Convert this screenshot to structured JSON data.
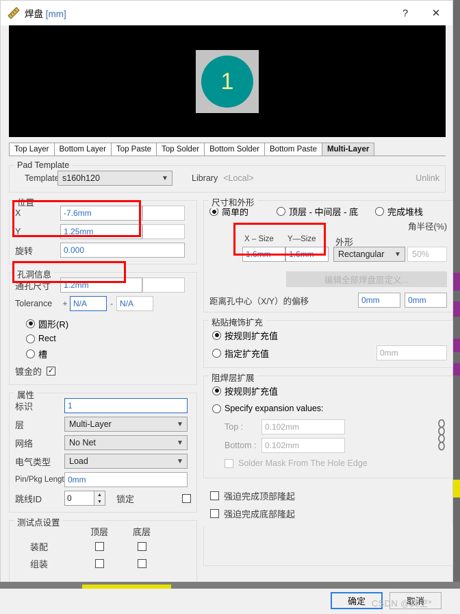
{
  "window": {
    "title": "焊盘",
    "title_unit": "[mm]",
    "icon": "ruler-icon",
    "help_glyph": "?",
    "close_glyph": "✕"
  },
  "preview": {
    "designator": "1",
    "pad_color": "#009291",
    "square_color": "#c3c3c3",
    "background_color": "#000000",
    "text_color": "#f5eb9a"
  },
  "tabs": [
    {
      "label": "Top Layer",
      "active": false
    },
    {
      "label": "Bottom Layer",
      "active": false
    },
    {
      "label": "Top Paste",
      "active": false
    },
    {
      "label": "Top Solder",
      "active": false
    },
    {
      "label": "Bottom Solder",
      "active": false
    },
    {
      "label": "Bottom Paste",
      "active": false
    },
    {
      "label": "Multi-Layer",
      "active": true
    }
  ],
  "pad_template": {
    "legend": "Pad Template",
    "template_label": "Template",
    "template_value": "s160h120",
    "library_label": "Library",
    "library_value": "<Local>",
    "unlink_label": "Unlink"
  },
  "position": {
    "legend": "位置",
    "x_label": "X",
    "x_value": "-7.6mm",
    "y_label": "Y",
    "y_value": "1.25mm",
    "rotation_label": "旋转",
    "rotation_value": "0.000"
  },
  "hole": {
    "legend": "孔洞信息",
    "size_label": "通孔尺寸",
    "size_value": "1.2mm",
    "tolerance_label": "Tolerance",
    "plus_sign": "+",
    "minus_sign": "-",
    "tolerance_plus": "N/A",
    "tolerance_minus": "N/A",
    "shape_round": "圆形(R)",
    "shape_rect": "Rect",
    "shape_slot": "槽",
    "plated_label": "镀金的",
    "plated_checked": true,
    "check_glyph": "✓"
  },
  "properties": {
    "legend": "属性",
    "designator_label": "标识",
    "designator_value": "1",
    "layer_label": "层",
    "layer_value": "Multi-Layer",
    "net_label": "网络",
    "net_value": "No Net",
    "electrical_label": "电气类型",
    "electrical_value": "Load",
    "pinpkg_label": "Pin/Pkg Length",
    "pinpkg_value": "0mm",
    "jumper_label": "跳线ID",
    "jumper_value": "0",
    "lock_label": "锁定",
    "lock_checked": false
  },
  "testpoint": {
    "legend": "测试点设置",
    "col_top": "顶层",
    "col_bottom": "底层",
    "row_assembly": "装配",
    "row_fabrication": "组装",
    "assembly_top_checked": false,
    "assembly_bottom_checked": false,
    "fab_top_checked": false,
    "fab_bottom_checked": false
  },
  "size_shape": {
    "legend": "尺寸和外形",
    "mode_simple": "简单的",
    "mode_topmidbottom": "顶层 - 中间层 - 底",
    "mode_fullstack": "完成堆栈",
    "selected_mode": "简单的",
    "x_size_label": "X – Size",
    "y_size_label": "Y—Size",
    "x_size_value": "1.6mm",
    "y_size_value": "1.6mm",
    "shape_label": "外形",
    "shape_value": "Rectangular",
    "corner_radius_label": "角半径(%)",
    "corner_radius_value": "50%",
    "edit_all_button": "编辑全部焊盘层定义...",
    "offset_label": "距离孔中心（X/Y）的偏移",
    "offset_x": "0mm",
    "offset_y": "0mm"
  },
  "paste_mask": {
    "legend": "粘贴掩饰扩充",
    "rule_option": "按规则扩充值",
    "specify_option": "指定扩充值",
    "specify_value": "0mm",
    "selected": "按规则扩充值"
  },
  "solder_mask": {
    "legend": "阻焊层扩展",
    "rule_option": "按规则扩充值",
    "specify_option": "Specify expansion values:",
    "selected": "按规则扩充值",
    "top_label": "Top :",
    "top_value": "0.102mm",
    "bottom_label": "Bottom :",
    "bottom_value": "0.102mm",
    "link_icon": "chain-link-icon",
    "hole_edge_label": "Solder Mask From The Hole Edge",
    "hole_edge_checked": false
  },
  "force_options": {
    "top_label": "强迫完成顶部隆起",
    "bottom_label": "强迫完成底部隆起",
    "top_checked": false,
    "bottom_checked": false
  },
  "footer": {
    "ok_label": "确定",
    "cancel_label": "取消",
    "watermark": "CSDN @真空*"
  },
  "annotations": {
    "accent_color": "#fb0505",
    "boxes": [
      "position-xy",
      "hole-size",
      "pad-size"
    ]
  }
}
